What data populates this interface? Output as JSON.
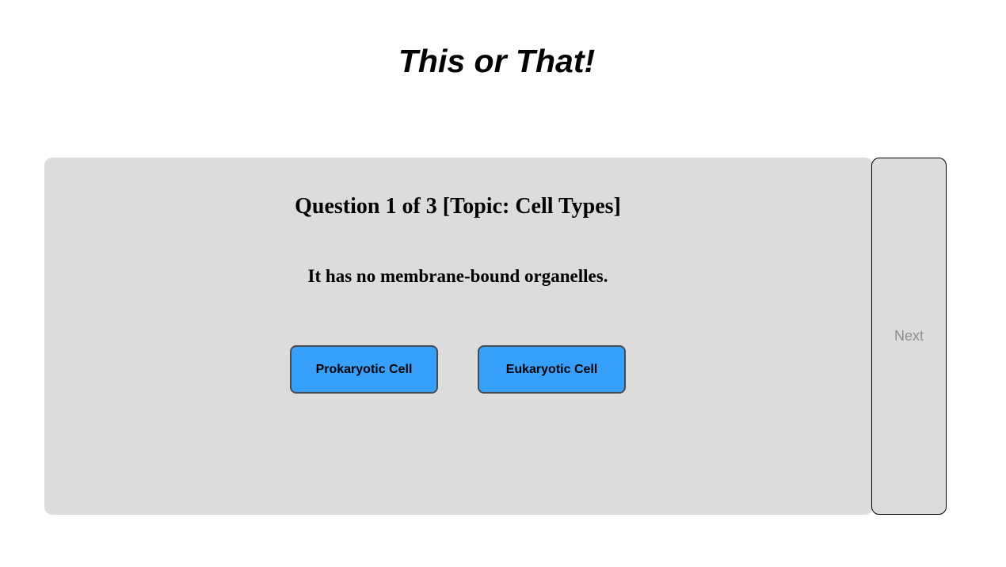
{
  "app": {
    "title": "This or That!"
  },
  "quiz": {
    "question_heading": "Question 1 of 3 [Topic: Cell Types]",
    "statement": "It has no membrane-bound organelles.",
    "options": [
      {
        "label": "Prokaryotic Cell"
      },
      {
        "label": "Eukaryotic Cell"
      }
    ]
  },
  "navigation": {
    "next_label": "Next",
    "next_enabled": false
  },
  "colors": {
    "answer_button": "#36a0fb",
    "panel_background": "#dcdcdc",
    "next_text_disabled": "#8e8e8e"
  }
}
